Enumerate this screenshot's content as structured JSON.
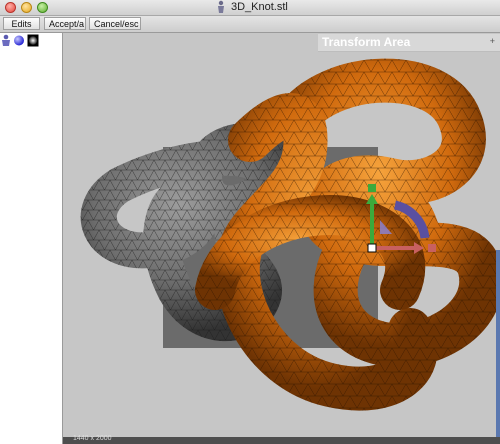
{
  "window": {
    "title": "3D_Knot.stl"
  },
  "toolbar": {
    "edits": "Edits",
    "accept": "Accept/a",
    "cancel": "Cancel/esc"
  },
  "panel": {
    "title": "Transform Area",
    "plus": "+"
  },
  "status": {
    "text": "1440 x 2000"
  },
  "colors": {
    "orange_knot": "#d4720f",
    "gray_knot": "#707070",
    "move_y": "#3caa3c",
    "move_x": "#c86060",
    "rotate": "#5a50a0"
  },
  "icons": [
    "app-figure-icon",
    "sphere-icon",
    "material-icon"
  ]
}
